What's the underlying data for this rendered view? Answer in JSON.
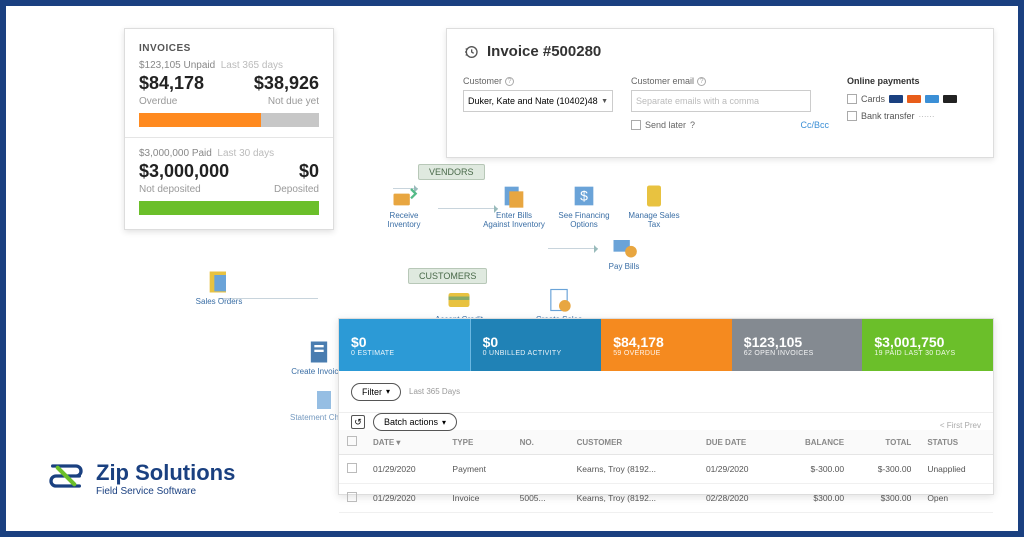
{
  "invoices_card": {
    "title": "INVOICES",
    "unpaid_line": "$123,105 Unpaid",
    "unpaid_period": "Last 365 days",
    "overdue_amount": "$84,178",
    "overdue_label": "Overdue",
    "notdue_amount": "$38,926",
    "notdue_label": "Not due yet",
    "paid_line": "$3,000,000 Paid",
    "paid_period": "Last 30 days",
    "notdep_amount": "$3,000,000",
    "notdep_label": "Not deposited",
    "dep_amount": "$0",
    "dep_label": "Deposited"
  },
  "invoice_detail": {
    "title": "Invoice #500280",
    "customer_label": "Customer",
    "customer_value": "Duker, Kate and Nate (10402)48",
    "email_label": "Customer email",
    "email_placeholder": "Separate emails with a comma",
    "send_later": "Send later",
    "ccbcc": "Cc/Bcc",
    "online_title": "Online payments",
    "cards_label": "Cards",
    "bank_label": "Bank transfer"
  },
  "workflow": {
    "vendors_header": "VENDORS",
    "customers_header": "CUSTOMERS",
    "sales_orders": "Sales Orders",
    "create_invoices": "Create Invoices",
    "statement_charges": "Statement Charges",
    "receive_inventory": "Receive Inventory",
    "enter_bills": "Enter Bills Against Inventory",
    "financing": "See Financing Options",
    "sales_tax": "Manage Sales Tax",
    "pay_bills": "Pay Bills",
    "accept_cards": "Accept Credit Cards",
    "sales_receipts": "Create Sales Receipts"
  },
  "dashboard": {
    "tiles": [
      {
        "amount": "$0",
        "label": "0 ESTIMATE"
      },
      {
        "amount": "$0",
        "label": "0 UNBILLED ACTIVITY"
      },
      {
        "amount": "$84,178",
        "label": "59 OVERDUE"
      },
      {
        "amount": "$123,105",
        "label": "62 OPEN INVOICES"
      },
      {
        "amount": "$3,001,750",
        "label": "19 PAID LAST 30 DAYS"
      }
    ],
    "filter_label": "Filter",
    "batch_label": "Batch actions",
    "period_label": "Last 365 Days",
    "pager": "< First   Prev",
    "columns": {
      "date": "DATE ▾",
      "type": "TYPE",
      "no": "NO.",
      "customer": "CUSTOMER",
      "due": "DUE DATE",
      "balance": "BALANCE",
      "total": "TOTAL",
      "status": "STATUS"
    },
    "rows": [
      {
        "date": "01/29/2020",
        "type": "Payment",
        "no": "",
        "customer": "Kearns, Troy (8192...",
        "due": "01/29/2020",
        "balance": "$-300.00",
        "total": "$-300.00",
        "status": "Unapplied"
      },
      {
        "date": "01/29/2020",
        "type": "Invoice",
        "no": "5005...",
        "customer": "Kearns, Troy (8192...",
        "due": "02/28/2020",
        "balance": "$300.00",
        "total": "$300.00",
        "status": "Open"
      }
    ]
  },
  "logo": {
    "name": "Zip Solutions",
    "tagline": "Field Service Software"
  }
}
